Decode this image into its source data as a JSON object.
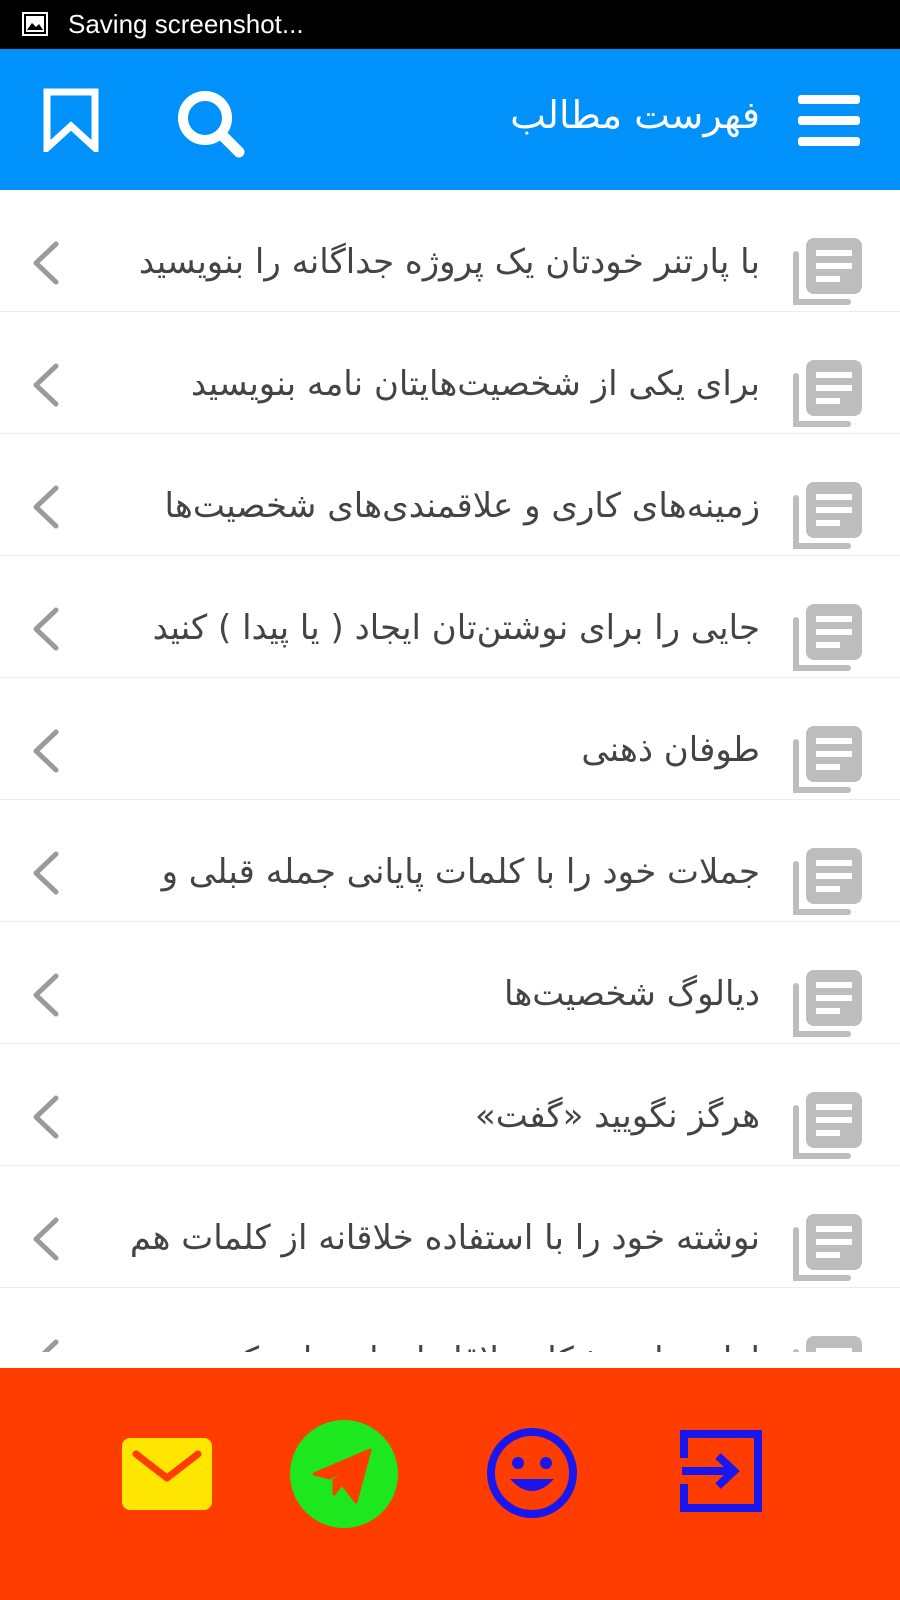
{
  "status_bar": {
    "text": "Saving screenshot...",
    "icon": "image-icon"
  },
  "app_bar": {
    "title": "فهرست مطالب",
    "menu_icon": "hamburger-menu-icon",
    "search_icon": "search-icon",
    "bookmark_icon": "bookmark-icon",
    "background_color": "#0191fa"
  },
  "list": {
    "item_icon": "article-icon",
    "chevron_icon": "chevron-left-icon",
    "items": [
      {
        "label": "با پارتنر خودتان یک پروژه جداگانه را بنویسید"
      },
      {
        "label": "برای یکی از شخصیت‌هایتان نامه بنویسید"
      },
      {
        "label": "زمینه‌های کاری و علاقمندی‌های شخصیت‌ها"
      },
      {
        "label": "جایی را برای نوشتن‌تان ایجاد ( یا پیدا ) کنید"
      },
      {
        "label": "طوفان ذهنی"
      },
      {
        "label": "جملات خود را با کلمات پایانی جمله قبلی و"
      },
      {
        "label": "دیالوگ شخصیت‌ها"
      },
      {
        "label": "هرگز نگویید «گفت»"
      },
      {
        "label": "نوشته خود را با استفاده خلاقانه از کلمات هم"
      },
      {
        "label": "لغات را به شکل خلاقانه‌ای استفاده کنید"
      }
    ]
  },
  "bottom_bar": {
    "background_color": "#ff3d00",
    "buttons": [
      {
        "icon": "mail-icon",
        "color": "#ffe600"
      },
      {
        "icon": "telegram-icon",
        "color": "#1de81d"
      },
      {
        "icon": "smile-icon",
        "color": "#1a16ee"
      },
      {
        "icon": "login-icon",
        "color": "#1a16ee"
      }
    ]
  }
}
